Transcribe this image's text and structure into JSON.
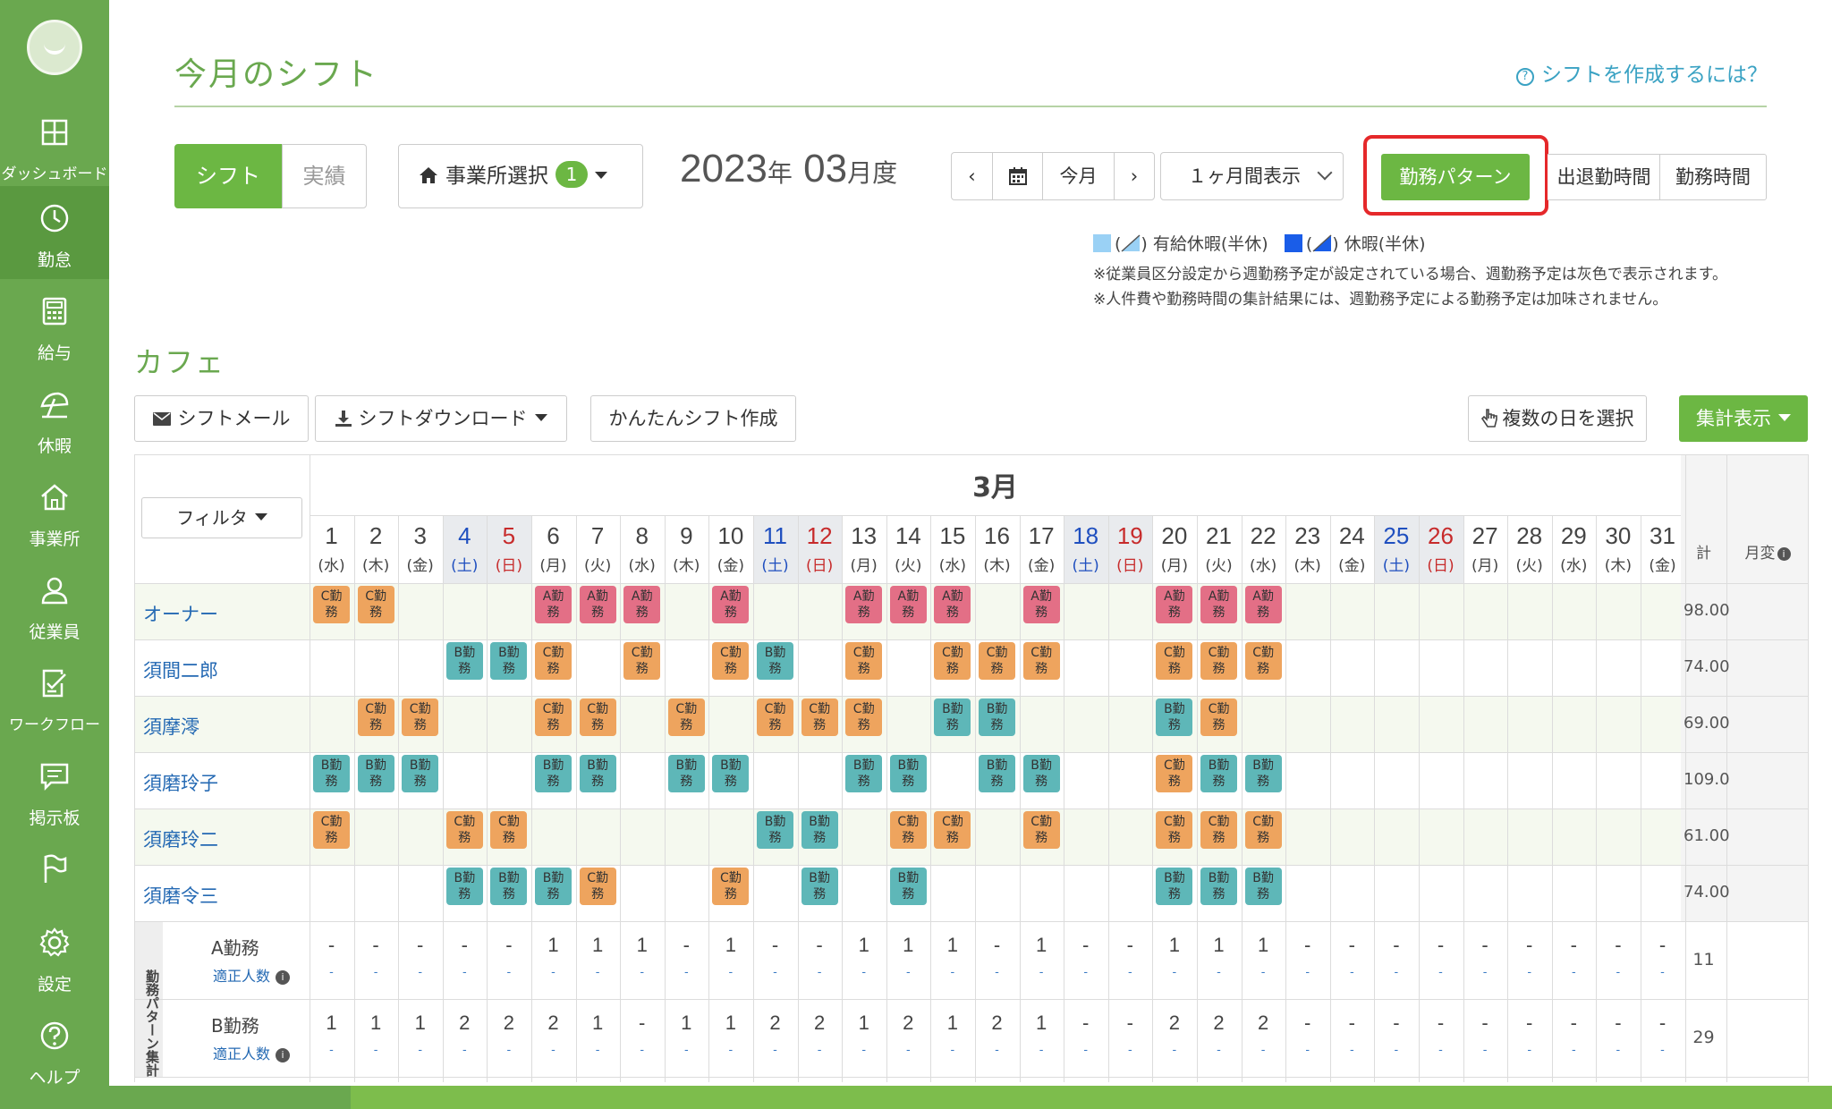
{
  "sidebar": {
    "items": [
      {
        "label": "ダッシュボード",
        "icon": "dashboard-icon"
      },
      {
        "label": "勤怠",
        "icon": "clock-icon"
      },
      {
        "label": "給与",
        "icon": "calculator-icon"
      },
      {
        "label": "休暇",
        "icon": "umbrella-icon"
      },
      {
        "label": "事業所",
        "icon": "home-icon"
      },
      {
        "label": "従業員",
        "icon": "person-icon"
      },
      {
        "label": "ワークフロー",
        "icon": "checklist-icon"
      },
      {
        "label": "掲示板",
        "icon": "chat-icon"
      },
      {
        "label": "",
        "icon": "flag-icon"
      },
      {
        "label": "設定",
        "icon": "gear-icon"
      },
      {
        "label": "ヘルプ",
        "icon": "help-icon"
      }
    ]
  },
  "header": {
    "title": "今月のシフト",
    "help_link": "シフトを作成するには？"
  },
  "toolbar": {
    "tab_shift": "シフト",
    "tab_actual": "実績",
    "office_select": "事業所選択",
    "office_badge": "1",
    "year": "2023",
    "year_unit": "年",
    "month": "03",
    "month_unit": "月度",
    "prev": "‹",
    "today": "今月",
    "next": "›",
    "period": "１ヶ月間表示",
    "btn_pattern": "勤務パターン",
    "btn_inout": "出退勤時間",
    "btn_worktime": "勤務時間"
  },
  "legend": {
    "paid_leave": "有給休暇(半休)",
    "leave": "休暇(半休)",
    "note1": "※従業員区分設定から週勤務予定が設定されている場合、週勤務予定は灰色で表示されます。",
    "note2": "※人件費や勤務時間の集計結果には、週勤務予定による勤務予定は加味されません。"
  },
  "section": {
    "title": "カフェ",
    "btn_mail": "シフトメール",
    "btn_download": "シフトダウンロード",
    "btn_easy": "かんたんシフト作成",
    "btn_multi": "複数の日を選択",
    "btn_summary": "集計表示"
  },
  "grid": {
    "month_label": "3月",
    "filter_label": "フィルタ",
    "total_header": "計",
    "change_header": "月変",
    "summary_side_label": "勤務パターン集計",
    "days": [
      {
        "n": "1",
        "w": "(水)"
      },
      {
        "n": "2",
        "w": "(木)"
      },
      {
        "n": "3",
        "w": "(金)"
      },
      {
        "n": "4",
        "w": "(土)"
      },
      {
        "n": "5",
        "w": "(日)"
      },
      {
        "n": "6",
        "w": "(月)"
      },
      {
        "n": "7",
        "w": "(火)"
      },
      {
        "n": "8",
        "w": "(水)"
      },
      {
        "n": "9",
        "w": "(木)"
      },
      {
        "n": "10",
        "w": "(金)"
      },
      {
        "n": "11",
        "w": "(土)"
      },
      {
        "n": "12",
        "w": "(日)"
      },
      {
        "n": "13",
        "w": "(月)"
      },
      {
        "n": "14",
        "w": "(火)"
      },
      {
        "n": "15",
        "w": "(水)"
      },
      {
        "n": "16",
        "w": "(木)"
      },
      {
        "n": "17",
        "w": "(金)"
      },
      {
        "n": "18",
        "w": "(土)"
      },
      {
        "n": "19",
        "w": "(日)"
      },
      {
        "n": "20",
        "w": "(月)"
      },
      {
        "n": "21",
        "w": "(火)"
      },
      {
        "n": "22",
        "w": "(水)"
      },
      {
        "n": "23",
        "w": "(木)"
      },
      {
        "n": "24",
        "w": "(金)"
      },
      {
        "n": "25",
        "w": "(土)"
      },
      {
        "n": "26",
        "w": "(日)"
      },
      {
        "n": "27",
        "w": "(月)"
      },
      {
        "n": "28",
        "w": "(火)"
      },
      {
        "n": "29",
        "w": "(水)"
      },
      {
        "n": "30",
        "w": "(木)"
      },
      {
        "n": "31",
        "w": "(金)"
      }
    ],
    "employees": [
      {
        "name": "オーナー",
        "total": "98.00",
        "shifts": [
          "C",
          "C",
          "",
          "",
          "",
          "A",
          "A",
          "A",
          "",
          "A",
          "",
          "",
          "A",
          "A",
          "A",
          "",
          "A",
          "",
          "",
          "A",
          "A",
          "A",
          "",
          "",
          "",
          "",
          "",
          "",
          "",
          "",
          ""
        ]
      },
      {
        "name": "須間二郎",
        "total": "74.00",
        "shifts": [
          "",
          "",
          "",
          "B",
          "B",
          "C",
          "",
          "C",
          "",
          "C",
          "B",
          "",
          "C",
          "",
          "C",
          "C",
          "C",
          "",
          "",
          "C",
          "C",
          "C",
          "",
          "",
          "",
          "",
          "",
          "",
          "",
          "",
          ""
        ]
      },
      {
        "name": "須摩澪",
        "total": "69.00",
        "shifts": [
          "",
          "C",
          "C",
          "",
          "",
          "C",
          "C",
          "",
          "C",
          "",
          "C",
          "C",
          "C",
          "",
          "B",
          "B",
          "",
          "",
          "",
          "B",
          "C",
          "",
          "",
          "",
          "",
          "",
          "",
          "",
          "",
          "",
          ""
        ]
      },
      {
        "name": "須磨玲子",
        "total": "109.0",
        "shifts": [
          "B",
          "B",
          "B",
          "",
          "",
          "B",
          "B",
          "",
          "B",
          "B",
          "",
          "",
          "B",
          "B",
          "",
          "B",
          "B",
          "",
          "",
          "C",
          "B",
          "B",
          "",
          "",
          "",
          "",
          "",
          "",
          "",
          "",
          ""
        ]
      },
      {
        "name": "須磨玲二",
        "total": "61.00",
        "shifts": [
          "C",
          "",
          "",
          "C",
          "C",
          "",
          "",
          "",
          "",
          "",
          "B",
          "B",
          "",
          "C",
          "C",
          "",
          "C",
          "",
          "",
          "C",
          "C",
          "C",
          "",
          "",
          "",
          "",
          "",
          "",
          "",
          "",
          ""
        ]
      },
      {
        "name": "須磨令三",
        "total": "74.00",
        "shifts": [
          "",
          "",
          "",
          "B",
          "B",
          "B",
          "C",
          "",
          "",
          "C",
          "",
          "B",
          "",
          "B",
          "",
          "",
          "",
          "",
          "",
          "B",
          "B",
          "B",
          "",
          "",
          "",
          "",
          "",
          "",
          "",
          "",
          ""
        ]
      }
    ],
    "shift_label_suffix": "勤務",
    "summary_rows": [
      {
        "label": "A勤務",
        "sub": "適正人数",
        "total": "11",
        "values": [
          "-",
          "-",
          "-",
          "-",
          "-",
          "1",
          "1",
          "1",
          "-",
          "1",
          "-",
          "-",
          "1",
          "1",
          "1",
          "-",
          "1",
          "-",
          "-",
          "1",
          "1",
          "1",
          "-",
          "-",
          "-",
          "-",
          "-",
          "-",
          "-",
          "-",
          "-"
        ]
      },
      {
        "label": "B勤務",
        "sub": "適正人数",
        "total": "29",
        "values": [
          "1",
          "1",
          "1",
          "2",
          "2",
          "2",
          "1",
          "-",
          "1",
          "1",
          "2",
          "2",
          "1",
          "2",
          "1",
          "2",
          "1",
          "-",
          "-",
          "2",
          "2",
          "2",
          "-",
          "-",
          "-",
          "-",
          "-",
          "-",
          "-",
          "-",
          "-"
        ]
      }
    ],
    "sub_dash": "-"
  },
  "colors": {
    "brand_green": "#6aa84f",
    "button_green": "#6cb743",
    "shift_a": "#e36f86",
    "shift_b": "#5eb7b8",
    "shift_c": "#eea45e",
    "saturday": "#1f4fbf",
    "sunday": "#c72b2b",
    "highlight": "#e5282a"
  }
}
